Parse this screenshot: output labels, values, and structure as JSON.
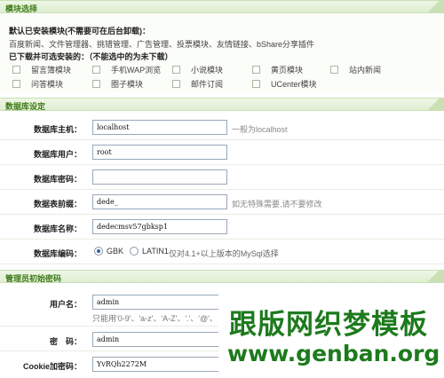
{
  "module_section": {
    "header": "模块选择",
    "installed_title": "默认已安装模块(不需要可在后台卸载)：",
    "installed_list": "百度新闻、文件管理器、挑错管理、广告管理、投票模块、友情链接、bShare分享插件",
    "optional_title": "已下载并可选安装的：（不能选中的为未下载）",
    "modules_row1": [
      "留言簿模块",
      "手机WAP浏览",
      "小说模块",
      "黄页模块",
      "站内新闻"
    ],
    "modules_row2": [
      "问答模块",
      "圈子模块",
      "邮件订阅",
      "UCenter模块"
    ]
  },
  "db_section": {
    "header": "数据库设定",
    "host": {
      "label": "数据库主机：",
      "value": "localhost",
      "hint": "一般为localhost"
    },
    "user": {
      "label": "数据库用户：",
      "value": "root"
    },
    "password": {
      "label": "数据库密码：",
      "value": ""
    },
    "prefix": {
      "label": "数据表前缀：",
      "value": "dede_",
      "hint": "如无特殊需要,请不要修改"
    },
    "name": {
      "label": "数据库名称：",
      "value": "dedecmsv57gbksp1"
    },
    "charset": {
      "label": "数据库编码：",
      "options": [
        "GBK",
        "LATIN1"
      ],
      "selected": "GBK",
      "hint": "仅对4.1+以上版本的MySql选择"
    }
  },
  "admin_section": {
    "header": "管理员初始密码",
    "username": {
      "label": "用户名：",
      "value": "admin",
      "hint": "只能用'0-9'、'a-z'、'A-Z'、'.'、'@'、"
    },
    "password": {
      "label": "密　码：",
      "value": "admin"
    },
    "cookie": {
      "label": "Cookie加密码：",
      "value": "YvRQh2272M"
    }
  },
  "watermark": {
    "line1": "跟版网织梦模板",
    "line2": "www.genban.org",
    "color": "#1d7a1d"
  },
  "colors": {
    "section_text": "#3e7a1a",
    "section_bg": "#e6f2dc"
  }
}
